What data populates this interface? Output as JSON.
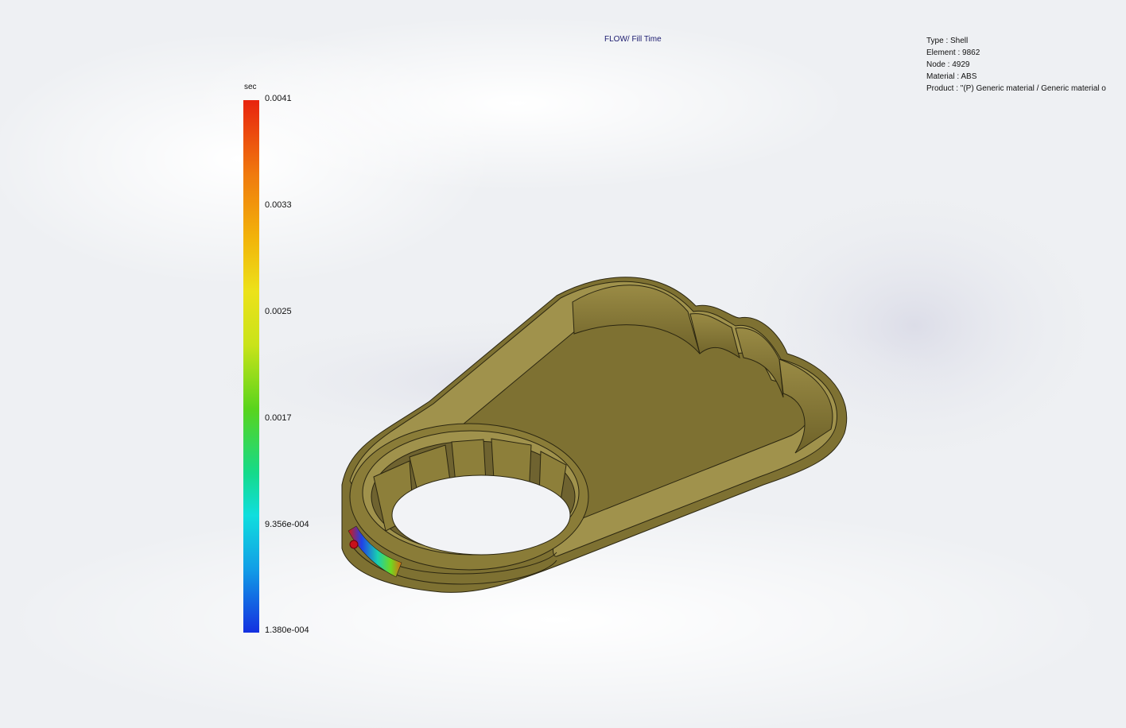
{
  "plot": {
    "title": "FLOW/ Fill Time"
  },
  "info": {
    "type": "Type : Shell",
    "element": "Element : 9862",
    "node": "Node : 4929",
    "material": "Material : ABS",
    "product": "Product :   \"(P)  Generic material / Generic material o"
  },
  "legend": {
    "unit": "sec",
    "ticks": [
      "0.0041",
      "0.0033",
      "0.0025",
      "0.0017",
      "9.356e-004",
      "1.380e-004"
    ],
    "colors": {
      "max": "#e8240e",
      "mid": "#59d41c",
      "min": "#1430e0"
    }
  },
  "model": {
    "part_color": "#8c7e3c",
    "icon": "injection-molded-part"
  }
}
